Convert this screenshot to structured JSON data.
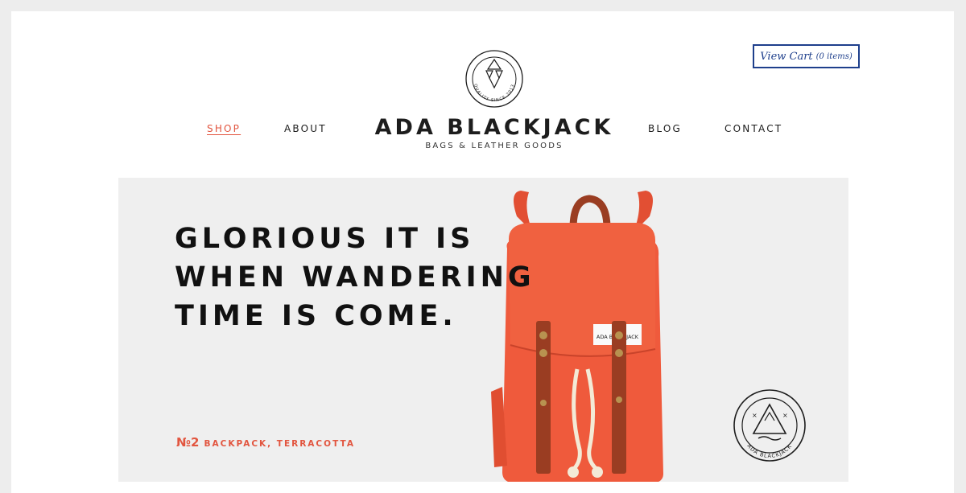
{
  "header": {
    "logo_seal_text": "QUALITY SINCE 2013",
    "brand_name": "ADA BLACKJACK",
    "brand_tagline": "BAGS & LEATHER GOODS",
    "nav": [
      {
        "label": "SHOP",
        "active": true
      },
      {
        "label": "ABOUT",
        "active": false
      },
      {
        "label": "BLOG",
        "active": false
      },
      {
        "label": "CONTACT",
        "active": false
      }
    ],
    "cart": {
      "label": "View Cart",
      "count": "(0 items)"
    }
  },
  "hero": {
    "headline": [
      "GLORIOUS IT IS",
      "WHEN WANDERING",
      "TIME IS COME."
    ],
    "product_number": "№2",
    "product_name": "BACKPACK, TERRACOTTA",
    "bag_label": "ADA BLACKJACK",
    "stamp_text": "ADA BLACKJACK"
  },
  "colors": {
    "accent": "#e2553f",
    "cart_blue": "#1e3f8c",
    "backpack": "#ef5a3c",
    "leather": "#9a3d22",
    "hero_bg": "#efefef"
  }
}
